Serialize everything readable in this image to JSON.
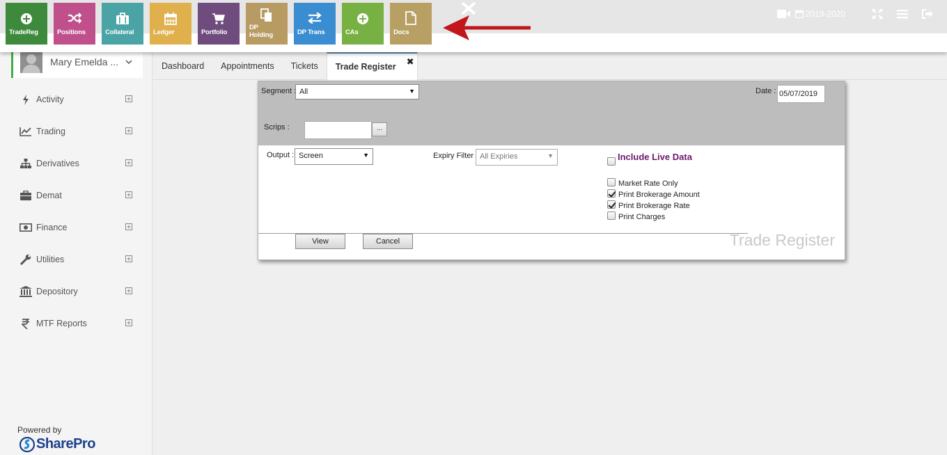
{
  "toolbar": {
    "tiles": [
      {
        "label": "TradeReg",
        "icon": "plus-circle-icon",
        "color": "#3d8a3c"
      },
      {
        "label": "Positions",
        "icon": "shuffle-icon",
        "color": "#c0508c"
      },
      {
        "label": "Collateral",
        "icon": "briefcase-icon",
        "color": "#4aa3a4"
      },
      {
        "label": "Ledger",
        "icon": "calendar-icon",
        "color": "#e0b04d"
      },
      {
        "label": "Portfolio",
        "icon": "cart-icon",
        "color": "#6f4c7d"
      },
      {
        "label": "DP Holding",
        "icon": "copy-icon",
        "color": "#b89a63"
      },
      {
        "label": "DP Trans",
        "icon": "transfer-arrows-icon",
        "color": "#3b8dd1"
      },
      {
        "label": "CAs",
        "icon": "plus-circle-icon",
        "color": "#78b143"
      },
      {
        "label": "Docs",
        "icon": "file-icon",
        "color": "#b8a064"
      }
    ],
    "financial_year": "2019-2020",
    "arrow_color": "#c0161c"
  },
  "sidebar": {
    "user_name": "Mary Emelda ...",
    "menu": [
      {
        "label": "Activity",
        "icon": "bolt-icon"
      },
      {
        "label": "Trading",
        "icon": "line-chart-icon"
      },
      {
        "label": "Derivatives",
        "icon": "sitemap-icon"
      },
      {
        "label": "Demat",
        "icon": "briefcase-icon"
      },
      {
        "label": "Finance",
        "icon": "money-icon"
      },
      {
        "label": "Utilities",
        "icon": "wrench-icon"
      },
      {
        "label": "Depository",
        "icon": "bank-icon"
      },
      {
        "label": "MTF Reports",
        "icon": "rupee-icon"
      }
    ],
    "powered_by": "Powered by",
    "brand": "SharePro"
  },
  "tabs": [
    "Dashboard",
    "Appointments",
    "Tickets",
    "Trade Register"
  ],
  "form": {
    "segment_label": "Segment :",
    "segment_value": "All",
    "date_label": "Date :",
    "date_value": "05/07/2019",
    "scrips_label": "Scrips :",
    "scrips_value": "",
    "browse_label": "...",
    "output_label": "Output :",
    "output_value": "Screen",
    "expiry_label": "Expiry Filter :",
    "expiry_value": "All Expiries",
    "include_live_label": "Include Live Data",
    "include_live_checked": false,
    "options": [
      {
        "label": "Market Rate Only",
        "checked": false
      },
      {
        "label": "Print Brokerage Amount",
        "checked": true
      },
      {
        "label": "Print Brokerage Rate",
        "checked": true
      },
      {
        "label": "Print Charges",
        "checked": false
      }
    ],
    "view_label": "View",
    "cancel_label": "Cancel",
    "watermark": "Trade Register"
  }
}
